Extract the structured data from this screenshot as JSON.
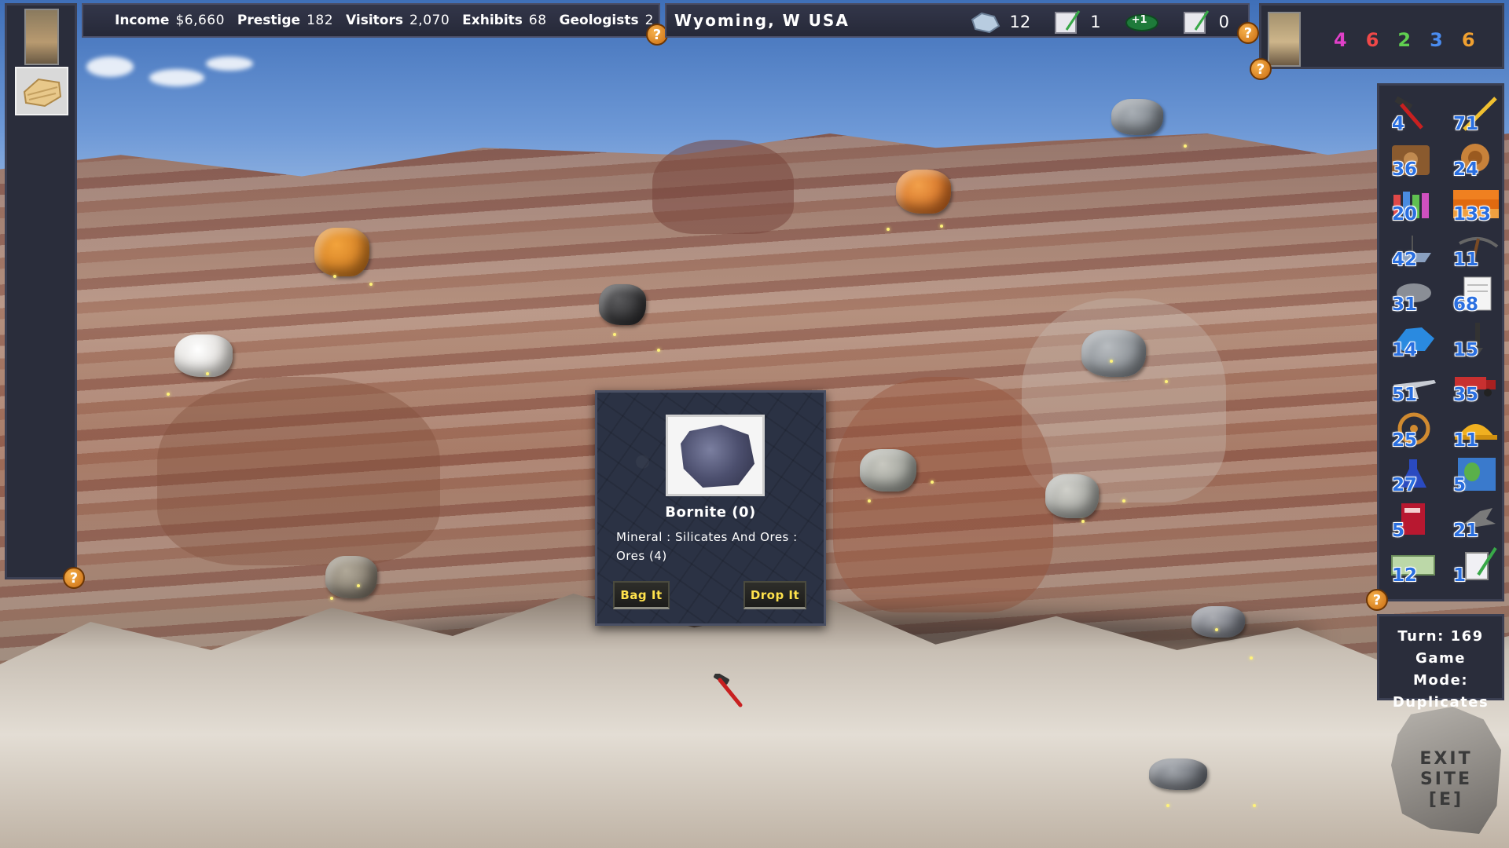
{
  "stats": {
    "income_label": "Income",
    "income_value": "$6,660",
    "prestige_label": "Prestige",
    "prestige_value": "182",
    "visitors_label": "Visitors",
    "visitors_value": "2,070",
    "exhibits_label": "Exhibits",
    "exhibits_value": "68",
    "geologists_label": "Geologists",
    "geologists_value": "2"
  },
  "location": {
    "name": "Wyoming, W USA",
    "counters": [
      {
        "icon": "rock-sample-icon",
        "value": "12"
      },
      {
        "icon": "permit-card-icon",
        "value": "1"
      },
      {
        "icon": "cash-bonus-icon",
        "badge": "+1"
      },
      {
        "icon": "permit-card-icon",
        "value": "0"
      }
    ]
  },
  "dice": [
    {
      "value": "4",
      "color": "#e040c8"
    },
    {
      "value": "6",
      "color": "#f04848"
    },
    {
      "value": "2",
      "color": "#60d050"
    },
    {
      "value": "3",
      "color": "#4a8cf0"
    },
    {
      "value": "6",
      "color": "#f0a030"
    }
  ],
  "inventory": [
    {
      "icon": "rock-hammer-icon",
      "count": "4"
    },
    {
      "icon": "brush-tool-icon",
      "count": "71"
    },
    {
      "icon": "fossil-plate-icon",
      "count": "36"
    },
    {
      "icon": "ammonite-icon",
      "count": "24"
    },
    {
      "icon": "visitors-group-icon",
      "count": "20"
    },
    {
      "icon": "strata-layers-icon",
      "count": "133"
    },
    {
      "icon": "boat-icon",
      "count": "42"
    },
    {
      "icon": "pickaxe-icon",
      "count": "11"
    },
    {
      "icon": "trilobite-icon",
      "count": "31"
    },
    {
      "icon": "notebook-icon",
      "count": "68"
    },
    {
      "icon": "water-mineral-icon",
      "count": "14"
    },
    {
      "icon": "drill-icon",
      "count": "15"
    },
    {
      "icon": "airplane-icon",
      "count": "51"
    },
    {
      "icon": "truck-icon",
      "count": "35"
    },
    {
      "icon": "compass-wheel-icon",
      "count": "25"
    },
    {
      "icon": "hard-hat-icon",
      "count": "11"
    },
    {
      "icon": "flask-icon",
      "count": "27"
    },
    {
      "icon": "globe-icon",
      "count": "5"
    },
    {
      "icon": "field-book-icon",
      "count": "5"
    },
    {
      "icon": "bird-fossil-icon",
      "count": "21"
    },
    {
      "icon": "cash-icon",
      "count": "12"
    },
    {
      "icon": "permit-card-icon",
      "count": "1"
    }
  ],
  "turn": {
    "turn_label": "Turn: 169",
    "mode_label": "Game Mode:",
    "mode_value": "Duplicates"
  },
  "exit": {
    "line1": "EXIT",
    "line2": "SITE",
    "line3": "[E]"
  },
  "dialog": {
    "title": "Bornite (0)",
    "description": "Mineral : Silicates And Ores : Ores (4)",
    "bag_label": "Bag It",
    "drop_label": "Drop It"
  },
  "help_glyph": "?",
  "colors": {
    "panel": "#2a2d3b",
    "accent_yellow": "#ffe24c",
    "help_orange": "#e08a20",
    "count_blue": "#2a6fe0"
  }
}
